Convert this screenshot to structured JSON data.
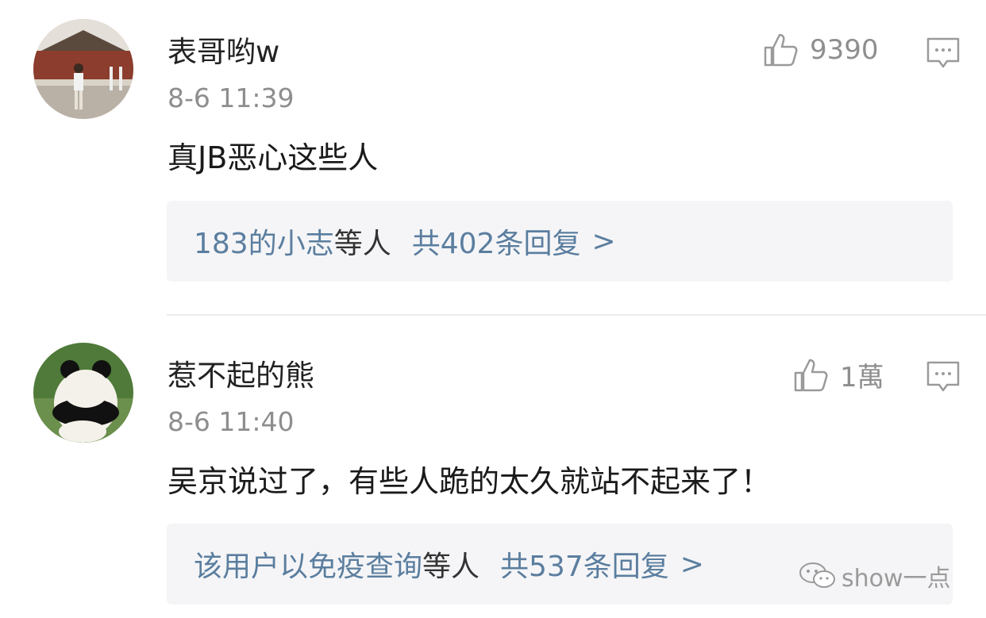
{
  "comments": [
    {
      "username": "表哥哟w",
      "time": "8-6 11:39",
      "likes": "9390",
      "text": "真JB恶心这些人",
      "reply_names": "183的小志",
      "reply_names_suffix": "等人",
      "reply_total": "共402条回复",
      "reply_arrow": ">"
    },
    {
      "username": "惹不起的熊",
      "time": "8-6 11:40",
      "likes": "1萬",
      "text": "吴京说过了，有些人跪的太久就站不起来了！",
      "reply_names": "该用户以免疫查询",
      "reply_names_suffix": "等人",
      "reply_total": "共537条回复",
      "reply_arrow": ">"
    }
  ],
  "watermark": {
    "text": "show一点",
    "icon": "wechat-icon"
  },
  "icons": {
    "like": "thumbs-up-icon",
    "reply": "comment-bubble-icon"
  },
  "colors": {
    "link": "#5b7e9f",
    "meta": "#8e8e8e",
    "reply_bg": "#f5f5f7"
  }
}
